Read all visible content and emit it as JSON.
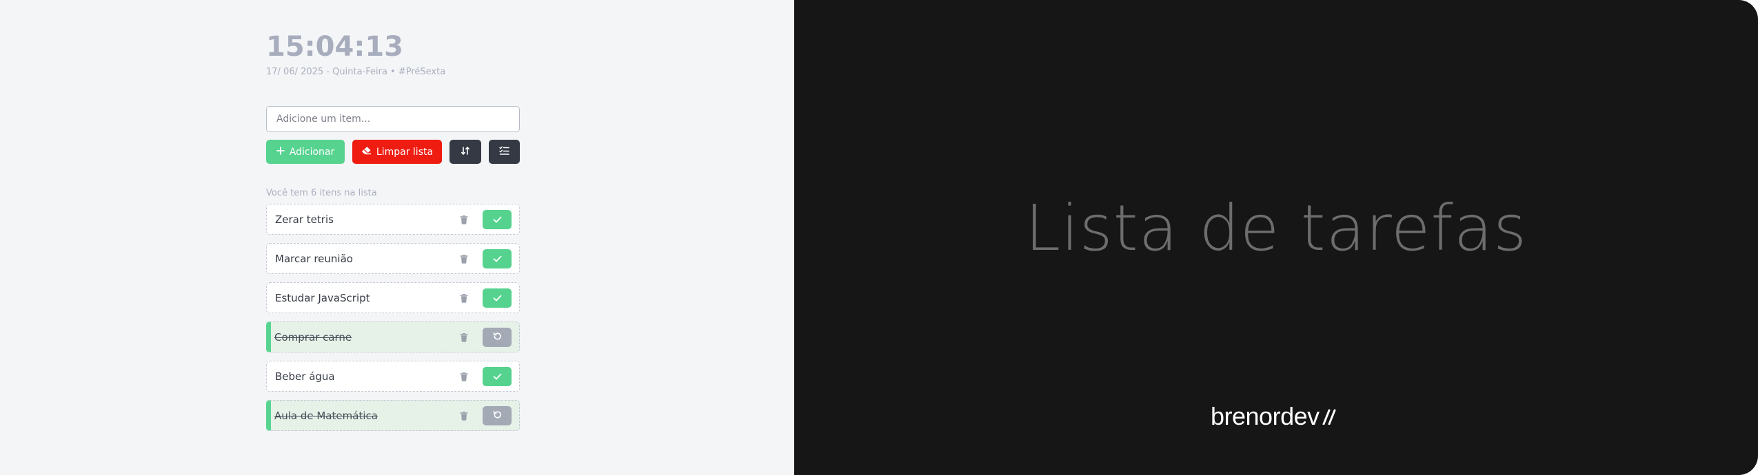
{
  "clock": {
    "time": "15:04:13",
    "date_line": "17/ 06/ 2025 - Quinta-Feira • #PréSexta"
  },
  "input": {
    "placeholder": "Adicione um item..."
  },
  "buttons": {
    "add_label": "Adicionar",
    "clear_label": "Limpar lista"
  },
  "count_text": "Você tem 6 itens na lista",
  "items": [
    {
      "label": "Zerar tetris",
      "done": false
    },
    {
      "label": "Marcar reunião",
      "done": false
    },
    {
      "label": "Estudar JavaScript",
      "done": false
    },
    {
      "label": "Comprar carne",
      "done": true
    },
    {
      "label": "Beber água",
      "done": false
    },
    {
      "label": "Aula de Matemática",
      "done": true
    }
  ],
  "hero": {
    "title": "Lista de tarefas"
  },
  "brand": {
    "name": "brenordev"
  },
  "colors": {
    "accent_green": "#56d38f",
    "danger_red": "#ef1c12",
    "dark_button": "#343944",
    "undo_gray": "#a4a9b6",
    "right_panel": "#161616"
  },
  "icons": {
    "add": "plus-icon",
    "clear": "eraser-icon",
    "sort": "sort-arrows-icon",
    "check_list": "checklist-icon",
    "delete": "trash-icon",
    "complete": "check-icon",
    "undo": "undo-icon"
  }
}
